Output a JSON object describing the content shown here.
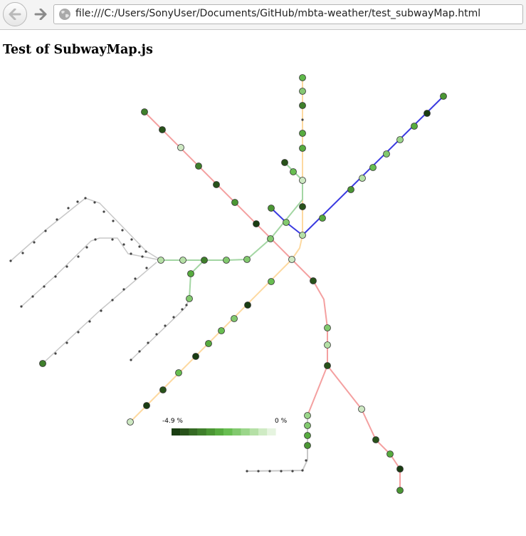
{
  "browser": {
    "url": "file:///C:/Users/SonyUser/Documents/GitHub/mbta-weather/test_subwayMap.html",
    "back_icon": "arrow-left-icon",
    "forward_icon": "arrow-right-icon",
    "site_icon": "globe-icon"
  },
  "page": {
    "title": "Test of SubwayMap.js"
  },
  "legend": {
    "min_label": "-4.9 %",
    "max_label": "0 %",
    "colors": [
      "#1a3d12",
      "#28521a",
      "#356a24",
      "#3f7f2b",
      "#4b9634",
      "#57ab3f",
      "#68be51",
      "#82c96e",
      "#9bd68a",
      "#b5e0a6",
      "#cfebc4",
      "#e6f4e0"
    ]
  },
  "colors": {
    "red_line": "#f4a0a0",
    "orange_line": "#fdd9a0",
    "blue_line": "#3a3ae0",
    "green_line": "#a3d6a3",
    "silver_line": "#c8c8c8"
  }
}
